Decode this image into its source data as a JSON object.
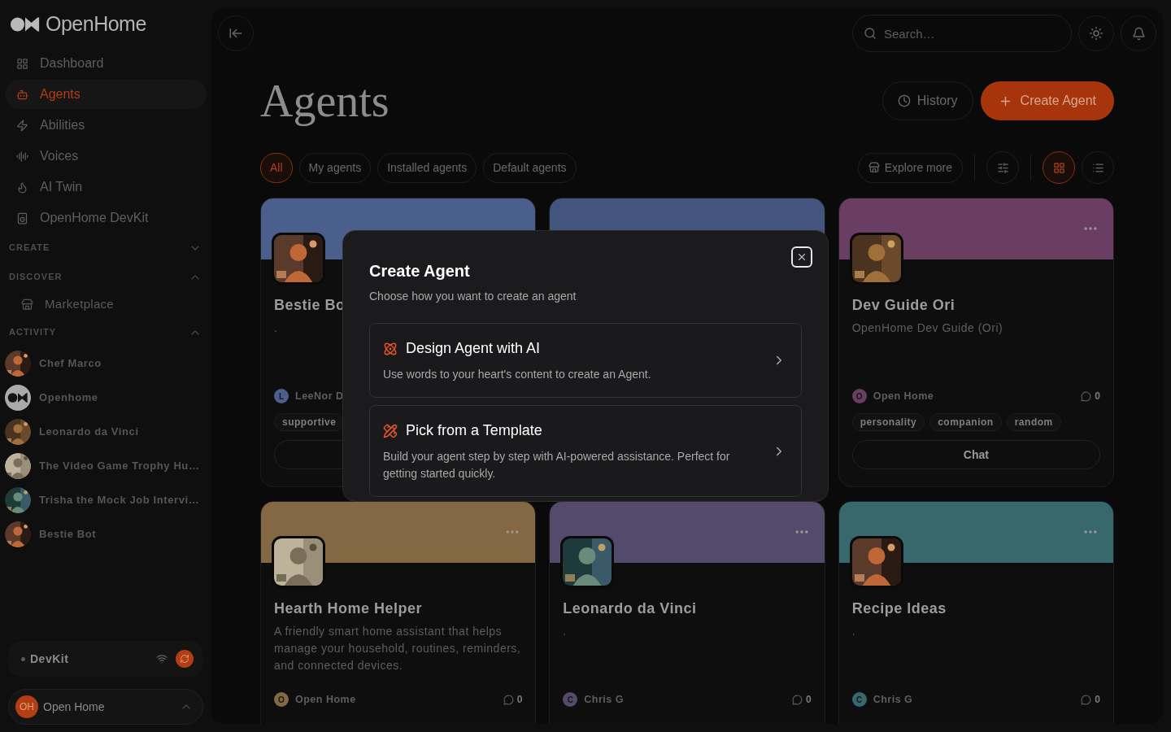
{
  "sidebar": {
    "logo": "OpenHome",
    "nav": [
      {
        "label": "Dashboard",
        "selected": false
      },
      {
        "label": "Agents",
        "selected": true
      },
      {
        "label": "Abilities",
        "selected": false
      },
      {
        "label": "Voices",
        "selected": false
      },
      {
        "label": "AI Twin",
        "selected": false
      },
      {
        "label": "OpenHome DevKit",
        "selected": false
      }
    ],
    "sections": [
      {
        "title": "CREATE",
        "expanded": false
      },
      {
        "title": "DISCOVER",
        "expanded": true,
        "items": [
          {
            "label": "Marketplace"
          }
        ]
      },
      {
        "title": "ACTIVITY",
        "expanded": true,
        "items": [
          {
            "label": "Chef Marco",
            "kind": "picture"
          },
          {
            "label": "Openhome",
            "kind": "logo"
          },
          {
            "label": "Leonardo da Vinci",
            "kind": "picture"
          },
          {
            "label": "The Video Game Trophy Hu…",
            "kind": "picture"
          },
          {
            "label": "Trisha the Mock Job Intervi…",
            "kind": "picture"
          },
          {
            "label": "Bestie Bot",
            "kind": "picture"
          }
        ]
      }
    ],
    "devkit": {
      "label": "DevKit"
    },
    "user": {
      "initials": "OH",
      "name": "Open Home"
    }
  },
  "topbar": {
    "search": {
      "placeholder": "Search…"
    }
  },
  "header": {
    "title": "Agents",
    "buttons": [
      {
        "label": "History",
        "kind": "secondary"
      },
      {
        "label": "Create Agent",
        "kind": "primary"
      }
    ]
  },
  "filters": [
    {
      "label": "All",
      "selected": true
    },
    {
      "label": "My agents",
      "selected": false
    },
    {
      "label": "Installed agents",
      "selected": false
    },
    {
      "label": "Default agents",
      "selected": false
    }
  ],
  "explore": {
    "label": "Explore more"
  },
  "view_modes": [
    {
      "kind": "grid",
      "selected": true
    },
    {
      "kind": "list",
      "selected": false
    }
  ],
  "cards": [
    {
      "color": "#4b5f8c",
      "title": "Bestie Bo",
      "description": ".",
      "author": "LeeNor D",
      "initial": "L",
      "tags": [
        "supportive"
      ],
      "chat_button": true
    },
    {
      "color": "#44557d"
    },
    {
      "color": "#6a3d62",
      "menu": true,
      "title": "Dev Guide Ori",
      "description": "OpenHome Dev Guide (Ori)",
      "author": "Open Home",
      "initial": "O",
      "comments": "0",
      "tags": [
        "personality",
        "companion",
        "random"
      ],
      "chat_button": true,
      "action": "Chat"
    },
    {
      "color": "#836843",
      "menu": true,
      "title": "Hearth Home Helper",
      "description": "A friendly smart home assistant that helps manage your household, routines, reminders, and connected devices.",
      "author": "Open Home",
      "initial": "O",
      "comments": "0"
    },
    {
      "color": "#544a6c",
      "menu": true,
      "title": "Leonardo da Vinci",
      "description": ".",
      "author": "Chris G",
      "initial": "C",
      "comments": "0"
    },
    {
      "color": "#37696c",
      "menu": true,
      "title": "Recipe Ideas",
      "description": ".",
      "author": "Chris G",
      "initial": "C",
      "comments": "0"
    }
  ],
  "dialog": {
    "title": "Create Agent",
    "subtitle": "Choose how you want to create an agent",
    "options": [
      {
        "title": "Design Agent with AI",
        "description": "Use words to your heart's content to create an Agent."
      },
      {
        "title": "Pick from a Template",
        "description": "Build your agent step by step with AI-powered assistance. Perfect for getting started quickly."
      }
    ]
  }
}
